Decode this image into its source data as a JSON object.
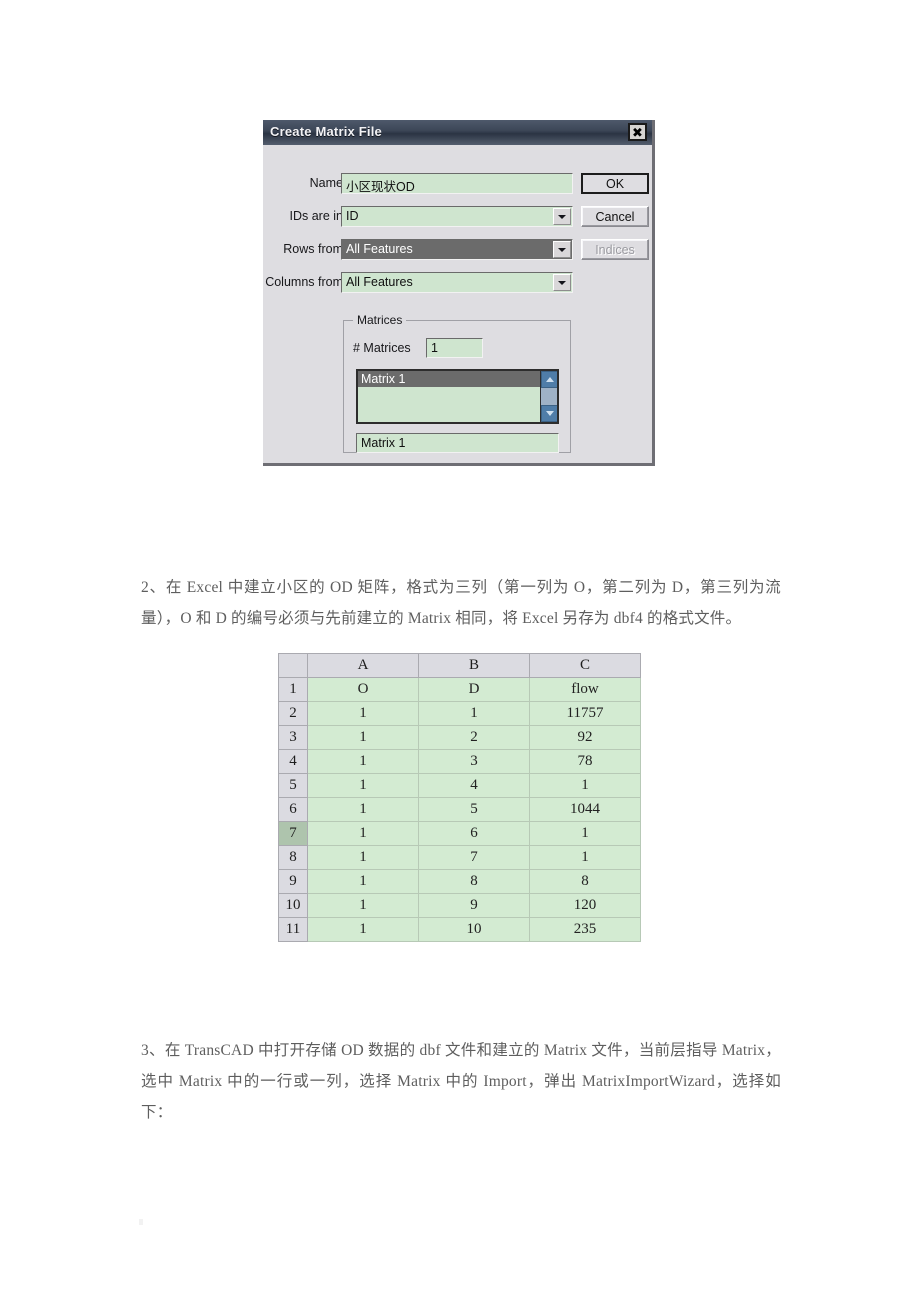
{
  "dialog": {
    "title": "Create Matrix File",
    "close_icon": "close-icon",
    "fields": [
      {
        "label": "Name",
        "value": "小区现状OD",
        "type": "text"
      },
      {
        "label": "IDs are in",
        "value": "ID",
        "type": "combo"
      },
      {
        "label": "Rows from",
        "value": "All Features",
        "type": "combo",
        "state": "selected"
      },
      {
        "label": "Columns from",
        "value": "All Features",
        "type": "combo"
      }
    ],
    "buttons": [
      {
        "label": "OK",
        "style": "default"
      },
      {
        "label": "Cancel",
        "style": "normal"
      },
      {
        "label": "Indices",
        "style": "disabled"
      }
    ],
    "group": {
      "title": "Matrices",
      "count_label": "# Matrices",
      "count_value": "1",
      "list_items": [
        "Matrix 1"
      ],
      "selected_item": "Matrix 1",
      "name_value": "Matrix 1",
      "scroll_up_icon": "chevron-up-icon",
      "scroll_down_icon": "chevron-down-icon"
    },
    "colors": {
      "field_bg": "#cfe5cf",
      "dialog_bg": "#dedde1",
      "selected_bg": "#6b6b6b",
      "titlebar": "#3c4657"
    }
  },
  "paragraphs": {
    "step2": "2、在 Excel 中建立小区的 OD 矩阵，格式为三列（第一列为 O，第二列为 D，第三列为流量），O 和 D 的编号必须与先前建立的 Matrix 相同，将 Excel 另存为 dbf4 的格式文件。",
    "step3": "3、在 TransCAD 中打开存储 OD 数据的 dbf 文件和建立的 Matrix 文件，当前层指导 Matrix，选中 Matrix 中的一行或一列，选择 Matrix 中的 Import，弹出 MatrixImportWizard，选择如下："
  },
  "spreadsheet": {
    "corner_label": "",
    "column_headers": [
      "A",
      "B",
      "C"
    ],
    "row_headers": [
      "1",
      "2",
      "3",
      "4",
      "5",
      "6",
      "7",
      "8",
      "9",
      "10",
      "11"
    ],
    "active_row": "7",
    "rows": [
      [
        "O",
        "D",
        "flow"
      ],
      [
        "1",
        "1",
        "11757"
      ],
      [
        "1",
        "2",
        "92"
      ],
      [
        "1",
        "3",
        "78"
      ],
      [
        "1",
        "4",
        "1"
      ],
      [
        "1",
        "5",
        "1044"
      ],
      [
        "1",
        "6",
        "1"
      ],
      [
        "1",
        "7",
        "1"
      ],
      [
        "1",
        "8",
        "8"
      ],
      [
        "1",
        "9",
        "120"
      ],
      [
        "1",
        "10",
        "235"
      ]
    ]
  }
}
